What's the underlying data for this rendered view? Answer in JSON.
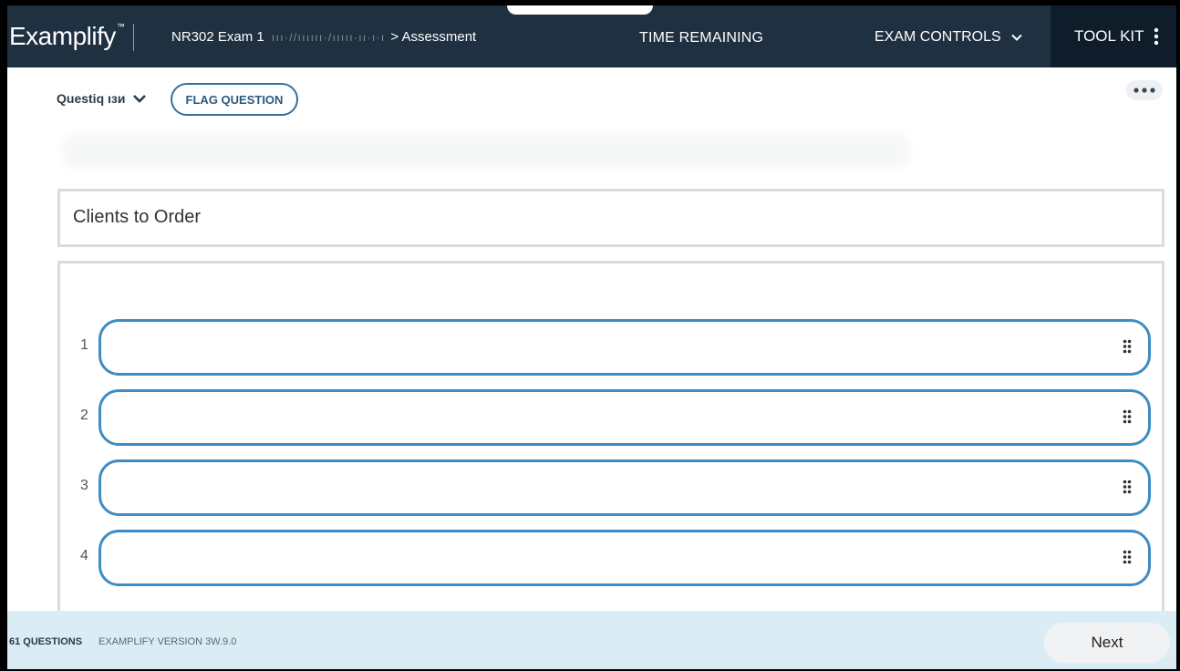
{
  "header": {
    "logo": "Examplify",
    "breadcrumb_course": "NR302 Exam 1",
    "breadcrumb_obscured": "ı ı ı · / / ı ı ı ı ı ı · / ı ı ı ı ı · ı ı · ı · ı",
    "breadcrumb_section": "> Assessment",
    "time_remaining_label": "TIME REMAINING",
    "exam_controls_label": "EXAM CONTROLS",
    "toolkit_label": "TOOL KIT"
  },
  "question_bar": {
    "question_selector_label": "Questiq ıзи",
    "flag_button_label": "FLAG QUESTION"
  },
  "question": {
    "title": "Clients to Order",
    "order_items": [
      {
        "number": "1"
      },
      {
        "number": "2"
      },
      {
        "number": "3"
      },
      {
        "number": "4"
      }
    ]
  },
  "footer": {
    "question_count": "61 QUESTIONS",
    "version": "EXAMPLIFY VERSION 3W.9.0",
    "next_label": "Next"
  },
  "colors": {
    "header_bg": "#1f3041",
    "toolkit_bg": "#0f1d2b",
    "accent_blue": "#3e8cc3",
    "footer_bg": "#daedf5"
  }
}
